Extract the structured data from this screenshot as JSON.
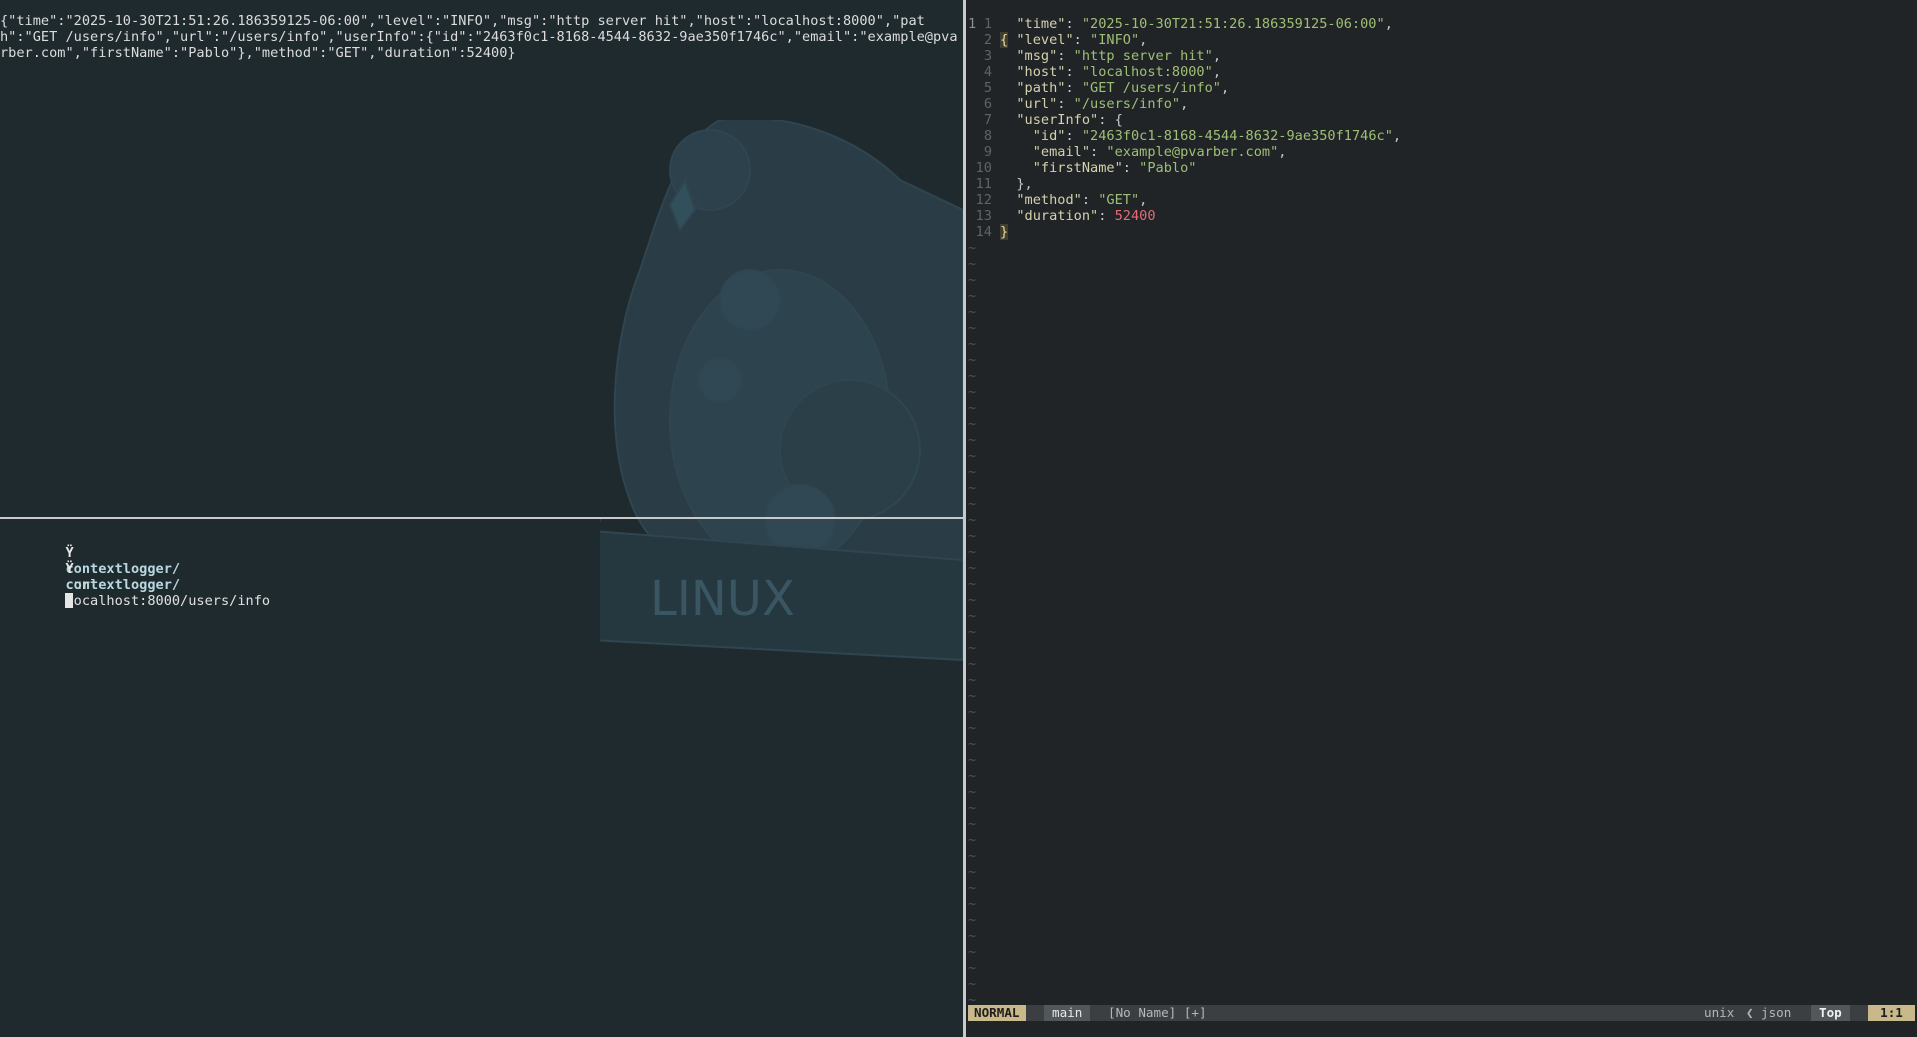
{
  "terminal": {
    "log_output": "{\"time\":\"2025-10-30T21:51:26.186359125-06:00\",\"level\":\"INFO\",\"msg\":\"http server hit\",\"host\":\"localhost:8000\",\"path\":\"GET /users/info\",\"url\":\"/users/info\",\"userInfo\":{\"id\":\"2463f0c1-8168-4544-8632-9ae350f1746c\",\"email\":\"example@pvarber.com\",\"firstName\":\"Pablo\"},\"method\":\"GET\",\"duration\":52400}",
    "prompt_glyph": "Ÿ",
    "prompt_dir": "contextlogger/",
    "command_name": "curl",
    "command_args": "localhost:8000/users/info",
    "wallpaper_text": "LINUX"
  },
  "editor": {
    "current_line_number": "1",
    "open_brace": "{",
    "close_brace": "}",
    "lines": [
      {
        "num": "1",
        "key": "\"time\"",
        "value": "\"2025-10-30T21:51:26.186359125-06:00\"",
        "tail": ","
      },
      {
        "num": "2",
        "key": "\"level\"",
        "value": "\"INFO\"",
        "tail": ","
      },
      {
        "num": "3",
        "key": "\"msg\"",
        "value": "\"http server hit\"",
        "tail": ","
      },
      {
        "num": "4",
        "key": "\"host\"",
        "value": "\"localhost:8000\"",
        "tail": ","
      },
      {
        "num": "5",
        "key": "\"path\"",
        "value": "\"GET /users/info\"",
        "tail": ","
      },
      {
        "num": "6",
        "key": "\"url\"",
        "value": "\"/users/info\"",
        "tail": ","
      },
      {
        "num": "7",
        "key": "\"userInfo\"",
        "value": "{",
        "tail": ""
      },
      {
        "num": "8",
        "key": "\"id\"",
        "value": "\"2463f0c1-8168-4544-8632-9ae350f1746c\"",
        "tail": ","
      },
      {
        "num": "9",
        "key": "\"email\"",
        "value": "\"example@pvarber.com\"",
        "tail": ","
      },
      {
        "num": "10",
        "key": "\"firstName\"",
        "value": "\"Pablo\"",
        "tail": ""
      },
      {
        "num": "11",
        "key": "",
        "value": "},",
        "tail": ""
      },
      {
        "num": "12",
        "key": "\"method\"",
        "value": "\"GET\"",
        "tail": ","
      },
      {
        "num": "13",
        "key": "\"duration\"",
        "value": "52400",
        "tail": ""
      },
      {
        "num": "14",
        "key": "",
        "value": "}",
        "tail": ""
      }
    ],
    "tilde": "~",
    "statusline": {
      "mode": "NORMAL",
      "branch": "main",
      "file": "[No Name] [+]",
      "format": "unix",
      "separator": "❮",
      "filetype": "json",
      "position": "Top",
      "cursor": "1:1"
    }
  },
  "colors": {
    "terminal_bg": "#1f2a2e",
    "editor_bg": "#212426",
    "string": "#9fbf76",
    "number": "#e06c75",
    "accent": "#c9b98a"
  }
}
